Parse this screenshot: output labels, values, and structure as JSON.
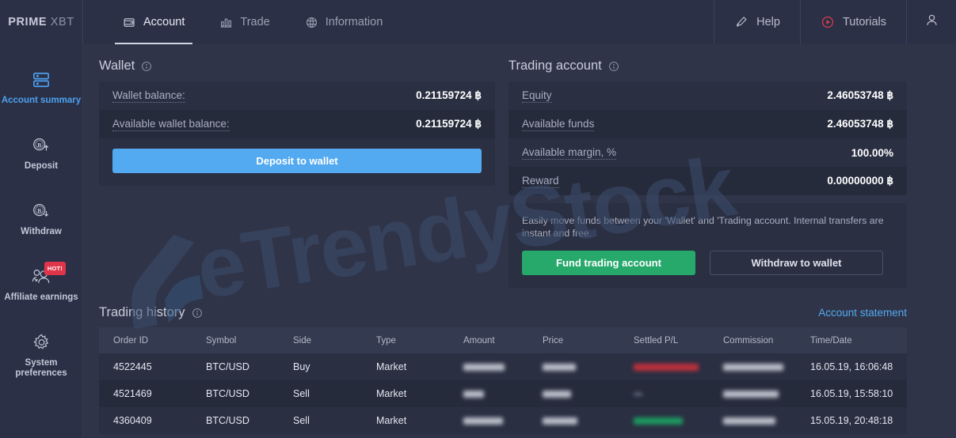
{
  "brand": {
    "name_bold": "PRIME",
    "name_light": "XBT"
  },
  "header": {
    "tabs": [
      {
        "label": "Account",
        "icon": "wallet-icon",
        "active": true
      },
      {
        "label": "Trade",
        "icon": "bar-chart-icon",
        "active": false
      },
      {
        "label": "Information",
        "icon": "globe-icon",
        "active": false
      }
    ],
    "help_label": "Help",
    "tutorials_label": "Tutorials",
    "profile_icon": "user-icon"
  },
  "sidebar": {
    "items": [
      {
        "label": "Account summary",
        "icon": "account-summary-icon",
        "active": true,
        "badge": ""
      },
      {
        "label": "Deposit",
        "icon": "bitcoin-up-icon",
        "active": false,
        "badge": ""
      },
      {
        "label": "Withdraw",
        "icon": "bitcoin-down-icon",
        "active": false,
        "badge": ""
      },
      {
        "label": "Affiliate earnings",
        "icon": "users-icon",
        "active": false,
        "badge": "HOT!"
      },
      {
        "label": "System preferences",
        "icon": "gear-icon",
        "active": false,
        "badge": ""
      }
    ]
  },
  "wallet": {
    "title": "Wallet",
    "rows": [
      {
        "label": "Wallet balance:",
        "value": "0.21159724 ฿"
      },
      {
        "label": "Available wallet balance:",
        "value": "0.21159724 ฿"
      }
    ],
    "deposit_button": "Deposit to wallet"
  },
  "trading_account": {
    "title": "Trading account",
    "rows": [
      {
        "label": "Equity",
        "value": "2.46053748 ฿"
      },
      {
        "label": "Available funds",
        "value": "2.46053748 ฿"
      },
      {
        "label": "Available margin, %",
        "value": "100.00%"
      },
      {
        "label": "Reward",
        "value": "0.00000000 ฿"
      }
    ],
    "transfer_note": "Easily move funds between your 'Wallet' and 'Trading account. Internal transfers are instant and free.",
    "fund_button": "Fund trading account",
    "withdraw_button": "Withdraw to wallet"
  },
  "trading_history": {
    "title": "Trading history",
    "statement_link": "Account statement",
    "columns": [
      "Order ID",
      "Symbol",
      "Side",
      "Type",
      "Amount",
      "Price",
      "Settled P/L",
      "Commission",
      "Time/Date"
    ],
    "rows": [
      {
        "order_id": "4522445",
        "symbol": "BTC/USD",
        "side": "Buy",
        "type": "Market",
        "amount": "",
        "price": "",
        "settled_pl": "",
        "commission": "",
        "time_date": "16.05.19, 16:06:48"
      },
      {
        "order_id": "4521469",
        "symbol": "BTC/USD",
        "side": "Sell",
        "type": "Market",
        "amount": "",
        "price": "",
        "settled_pl": "",
        "commission": "",
        "time_date": "16.05.19, 15:58:10"
      },
      {
        "order_id": "4360409",
        "symbol": "BTC/USD",
        "side": "Sell",
        "type": "Market",
        "amount": "",
        "price": "",
        "settled_pl": "",
        "commission": "",
        "time_date": "15.05.19, 20:48:18"
      }
    ]
  },
  "watermark": {
    "text": "eTrendyStock"
  },
  "colors": {
    "accent_blue": "#53aaf0",
    "green": "#27a96c",
    "buy_green": "#27c07e",
    "sell_red": "#e8454e",
    "hot_red": "#e0344a",
    "panel": "#2a2f42",
    "background": "#2f3448",
    "chrome": "#2b3046"
  }
}
